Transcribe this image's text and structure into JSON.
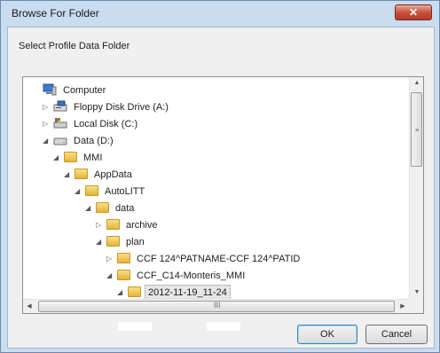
{
  "window": {
    "title": "Browse For Folder",
    "close_label": "✕"
  },
  "prompt": "Select Profile Data Folder",
  "tree": [
    {
      "label": "Computer",
      "icon": "computer-icon",
      "arrow": "",
      "indent": 0
    },
    {
      "label": "Floppy Disk Drive (A:)",
      "icon": "floppy-drive-icon",
      "arrow": "▷",
      "indent": 1
    },
    {
      "label": "Local Disk (C:)",
      "icon": "local-disk-icon",
      "arrow": "▷",
      "indent": 1
    },
    {
      "label": "Data (D:)",
      "icon": "drive-icon",
      "arrow": "◢",
      "indent": 1
    },
    {
      "label": "MMI",
      "icon": "folder-icon",
      "arrow": "◢",
      "indent": 2
    },
    {
      "label": "AppData",
      "icon": "folder-icon",
      "arrow": "◢",
      "indent": 3
    },
    {
      "label": "AutoLITT",
      "icon": "folder-icon",
      "arrow": "◢",
      "indent": 4
    },
    {
      "label": "data",
      "icon": "folder-icon",
      "arrow": "◢",
      "indent": 5
    },
    {
      "label": "archive",
      "icon": "folder-icon",
      "arrow": "▷",
      "indent": 6
    },
    {
      "label": "plan",
      "icon": "folder-icon",
      "arrow": "◢",
      "indent": 6
    },
    {
      "label": "CCF 124^PATNAME-CCF 124^PATID",
      "icon": "folder-icon",
      "arrow": "▷",
      "indent": 7
    },
    {
      "label": "CCF_C14-Monteris_MMI",
      "icon": "folder-icon",
      "arrow": "◢",
      "indent": 7
    },
    {
      "label": "2012-11-19_11-24",
      "icon": "folder-icon",
      "arrow": "◢",
      "indent": 8,
      "selected": true
    }
  ],
  "scrollbar": {
    "grip": "≡",
    "hgrip": "III"
  },
  "buttons": {
    "ok": "OK",
    "cancel": "Cancel"
  }
}
